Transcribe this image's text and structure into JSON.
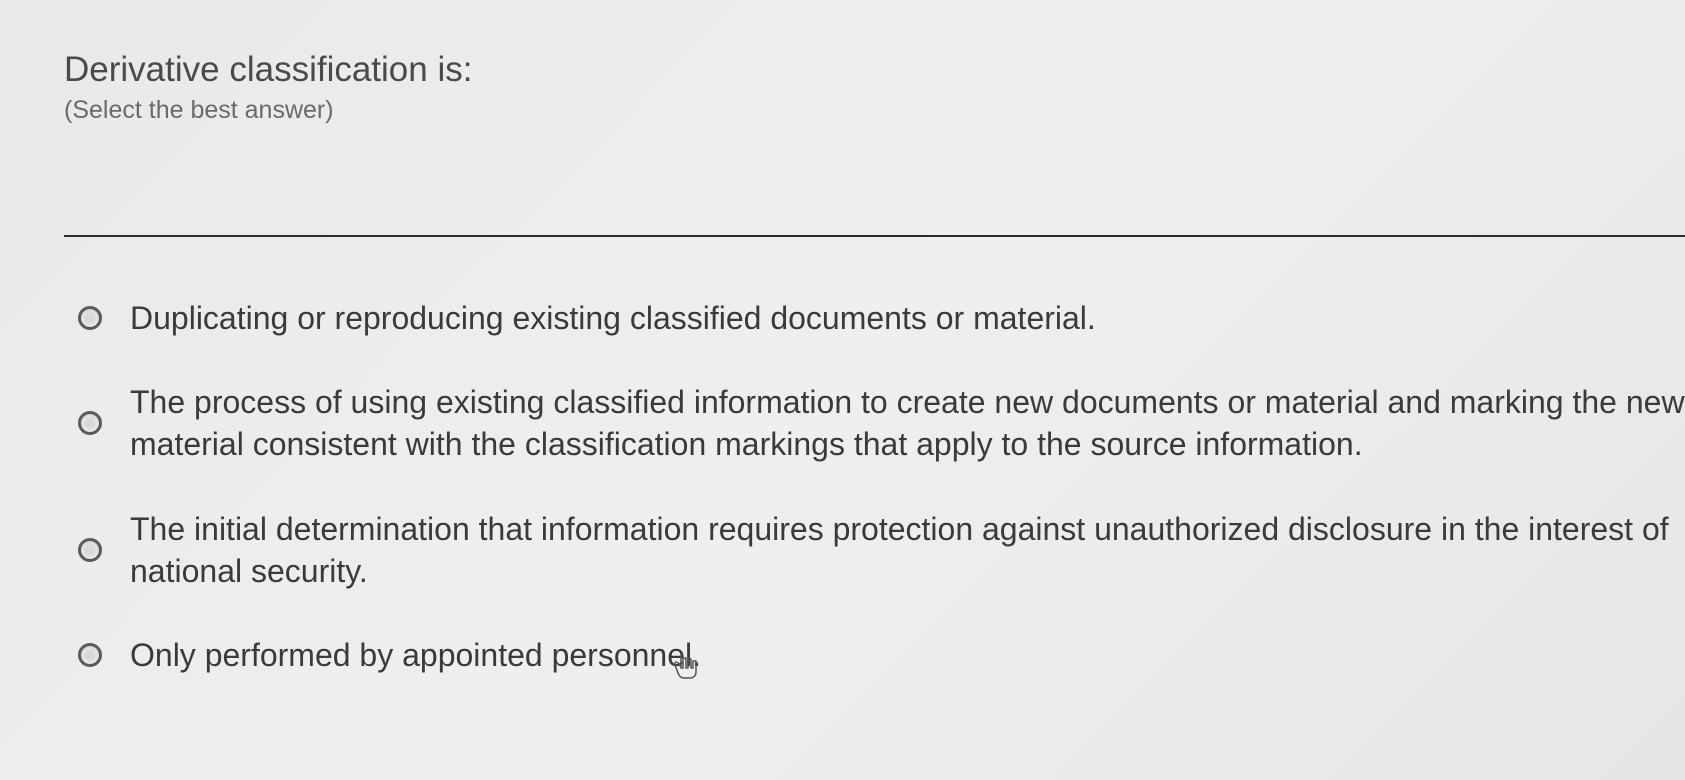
{
  "question": {
    "prompt": "Derivative classification is:",
    "instruction": "(Select the best answer)"
  },
  "options": [
    {
      "text": "Duplicating or reproducing existing classified documents or material.",
      "selected": false
    },
    {
      "text": "The process of using existing classified information to create new documents or material and marking the new material consistent with the classification markings that apply to the source information.",
      "selected": false
    },
    {
      "text": "The initial determination that information requires protection against unauthorized disclosure in the interest of national security.",
      "selected": false
    },
    {
      "text": "Only performed by appointed personnel.",
      "selected": false
    }
  ]
}
